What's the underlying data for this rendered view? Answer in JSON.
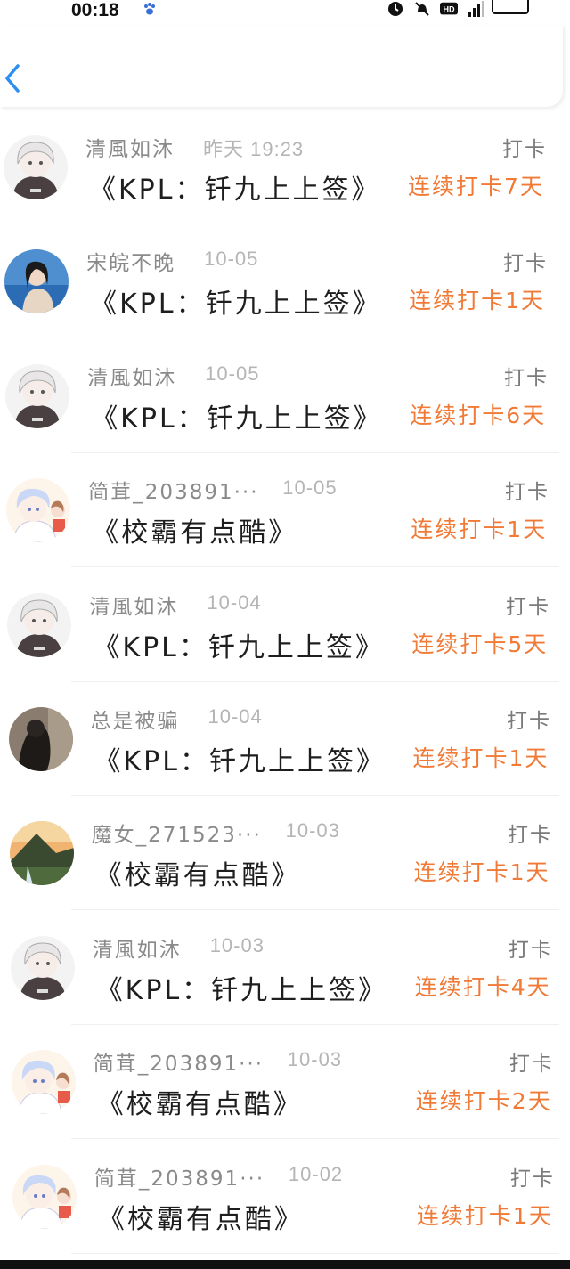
{
  "status_bar": {
    "time": "00:18",
    "icons": [
      "paw-icon",
      "alarm-icon",
      "mute-icon",
      "hd-icon",
      "signal-icon",
      "battery-icon"
    ]
  },
  "colors": {
    "streak": "#f07a36",
    "name": "#8a8a8a",
    "date": "#b5b5b5",
    "back": "#2a8ff0"
  },
  "rows": [
    {
      "name": "清風如沐",
      "date": "昨天 19:23",
      "tag": "打卡",
      "book": "《KPL：钎九上上签》",
      "streak": "连续打卡7天",
      "avatar": "anime-gray"
    },
    {
      "name": "宋皖不晚",
      "date": "10-05",
      "tag": "打卡",
      "book": "《KPL：钎九上上签》",
      "streak": "连续打卡1天",
      "avatar": "sea-girl"
    },
    {
      "name": "清風如沐",
      "date": "10-05",
      "tag": "打卡",
      "book": "《KPL：钎九上上签》",
      "streak": "连续打卡6天",
      "avatar": "anime-gray"
    },
    {
      "name": "简茸_203891···",
      "date": "10-05",
      "tag": "打卡",
      "book": "《校霸有点酷》",
      "streak": "连续打卡1天",
      "avatar": "anime-blue"
    },
    {
      "name": "清風如沐",
      "date": "10-04",
      "tag": "打卡",
      "book": "《KPL：钎九上上签》",
      "streak": "连续打卡5天",
      "avatar": "anime-gray"
    },
    {
      "name": "总是被骗",
      "date": "10-04",
      "tag": "打卡",
      "book": "《KPL：钎九上上签》",
      "streak": "连续打卡1天",
      "avatar": "dark-photo"
    },
    {
      "name": "魔女_271523···",
      "date": "10-03",
      "tag": "打卡",
      "book": "《校霸有点酷》",
      "streak": "连续打卡1天",
      "avatar": "landscape"
    },
    {
      "name": "清風如沐",
      "date": "10-03",
      "tag": "打卡",
      "book": "《KPL：钎九上上签》",
      "streak": "连续打卡4天",
      "avatar": "anime-gray"
    },
    {
      "name": "简茸_203891···",
      "date": "10-03",
      "tag": "打卡",
      "book": "《校霸有点酷》",
      "streak": "连续打卡2天",
      "avatar": "anime-blue"
    },
    {
      "name": "简茸_203891···",
      "date": "10-02",
      "tag": "打卡",
      "book": "《校霸有点酷》",
      "streak": "连续打卡1天",
      "avatar": "anime-blue"
    }
  ]
}
